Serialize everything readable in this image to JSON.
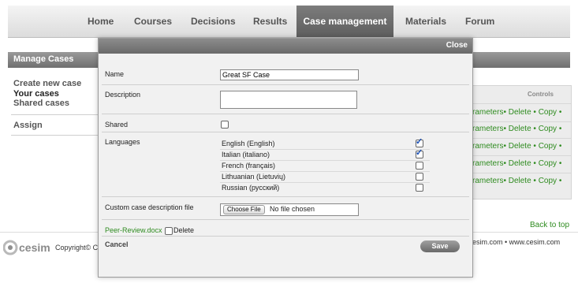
{
  "nav": {
    "items": [
      "Home",
      "Courses",
      "Decisions",
      "Results",
      "Case management",
      "Materials",
      "Forum"
    ],
    "active": "Case management"
  },
  "sidebar": {
    "title": "Manage Cases",
    "links": [
      "Create new case",
      "Your cases",
      "Shared cases",
      "Assign"
    ]
  },
  "table": {
    "header": "Controls",
    "row_controls": "rameters• Delete • Copy •",
    "rows": 5
  },
  "modal": {
    "close": "Close",
    "name_label": "Name",
    "name_value": "Great SF Case",
    "description_label": "Description",
    "description_value": "",
    "shared_label": "Shared",
    "languages_label": "Languages",
    "languages": [
      {
        "name": "English (English)",
        "checked": true
      },
      {
        "name": "Italian (italiano)",
        "checked": true
      },
      {
        "name": "French (français)",
        "checked": false
      },
      {
        "name": "Lithuanian (Lietuvių)",
        "checked": false
      },
      {
        "name": "Russian (русский)",
        "checked": false
      }
    ],
    "custom_file_label": "Custom case description file",
    "choose_file": "Choose File",
    "no_file": "No file chosen",
    "existing_file": "Peer-Review.docx",
    "delete_label": "Delete",
    "cancel": "Cancel",
    "save": "Save"
  },
  "footer": {
    "back_to_top": "Back to top",
    "copyright": "Copyright© Ce",
    "right": "esim.com  •  www.cesim.com",
    "logo_text": "cesim"
  },
  "colors": {
    "link_green": "#2e8b1f",
    "header_gray": "#6a6a6a",
    "checkbox_blue": "#1a4fb5"
  }
}
